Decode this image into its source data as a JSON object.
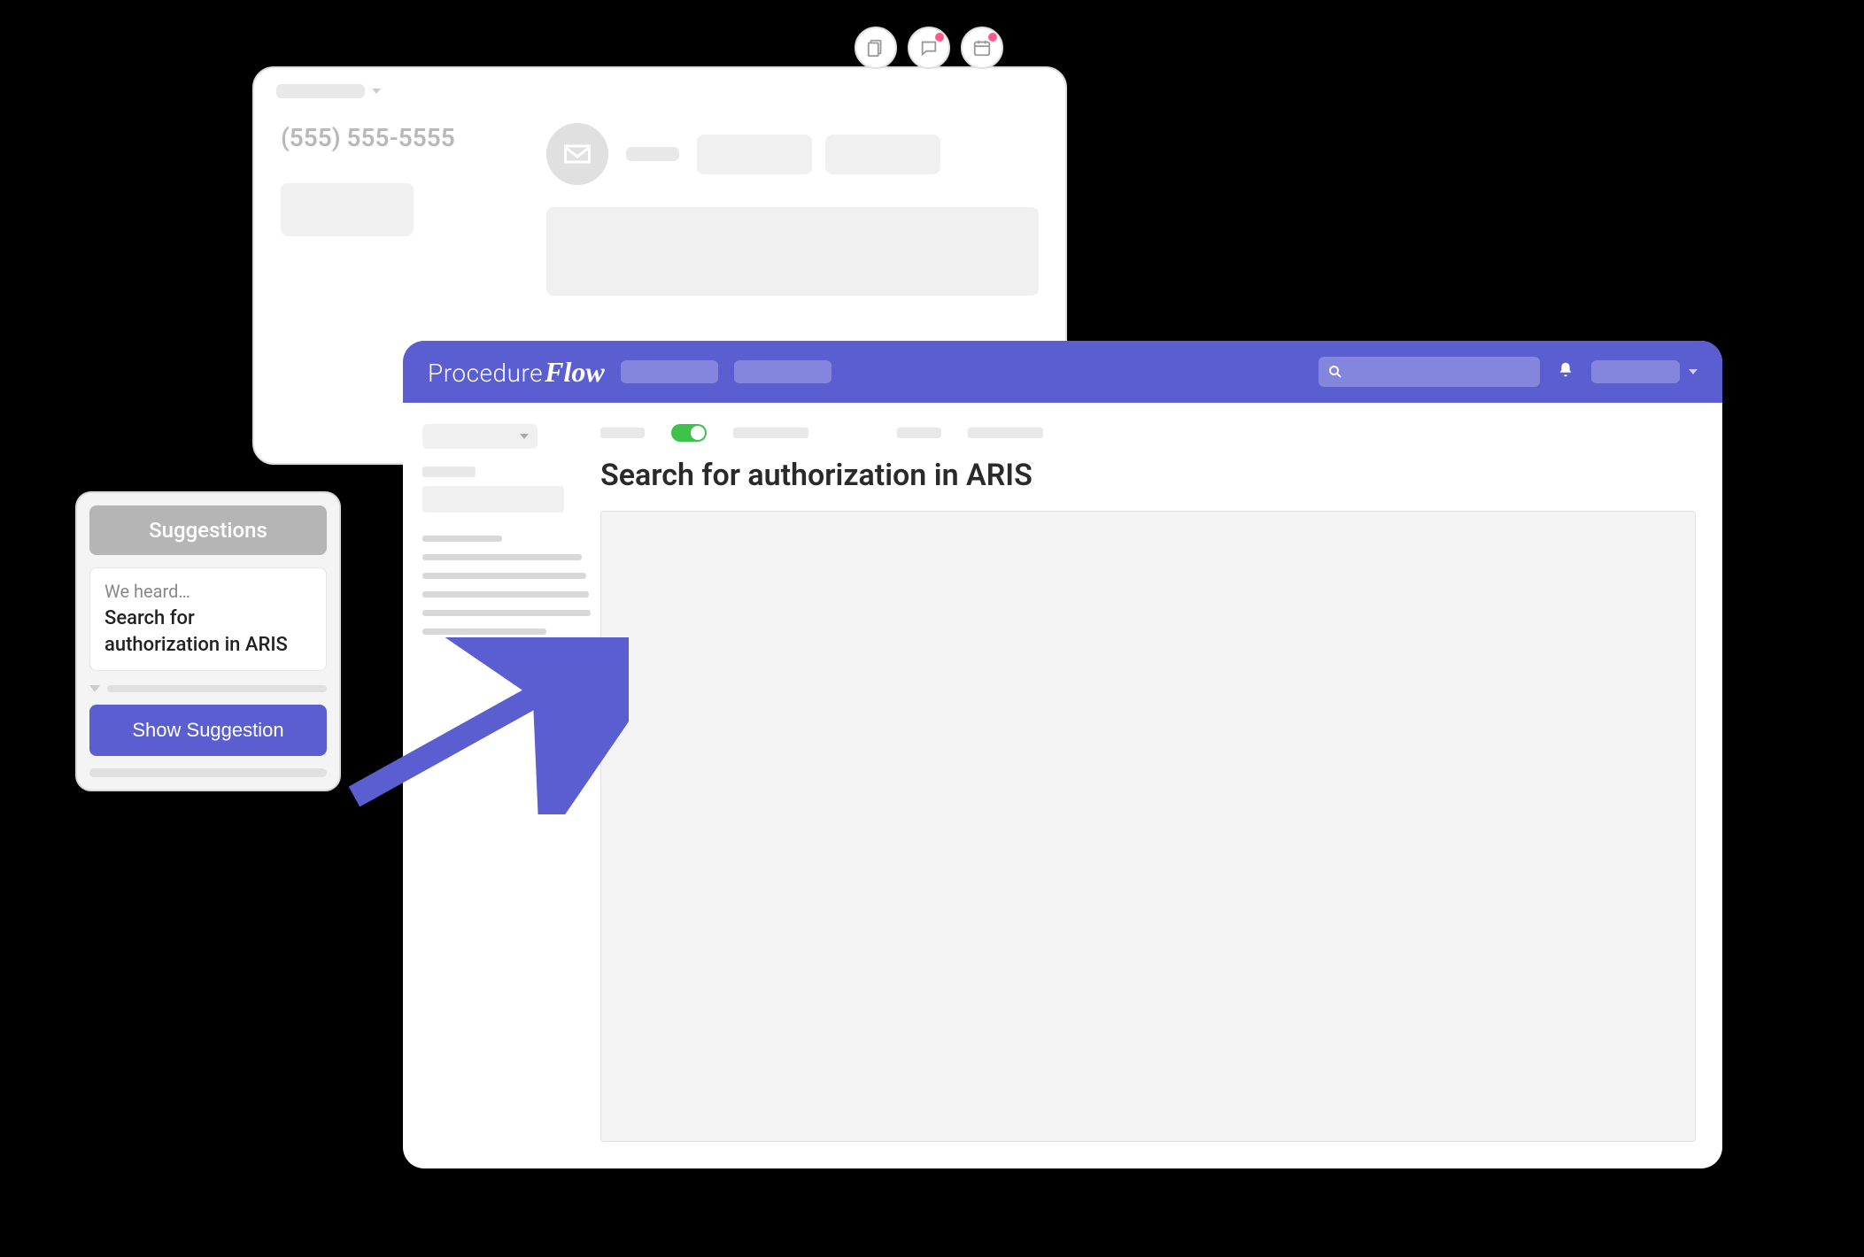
{
  "crm": {
    "phone": "(555) 555-5555"
  },
  "suggestions": {
    "header": "Suggestions",
    "we_heard_label": "We heard…",
    "suggestion_text": "Search for authorization in ARIS",
    "button_label": "Show Suggestion"
  },
  "procedureflow": {
    "logo_word1": "Procedure",
    "logo_word2": "Flow",
    "page_title": "Search for authorization in ARIS"
  }
}
